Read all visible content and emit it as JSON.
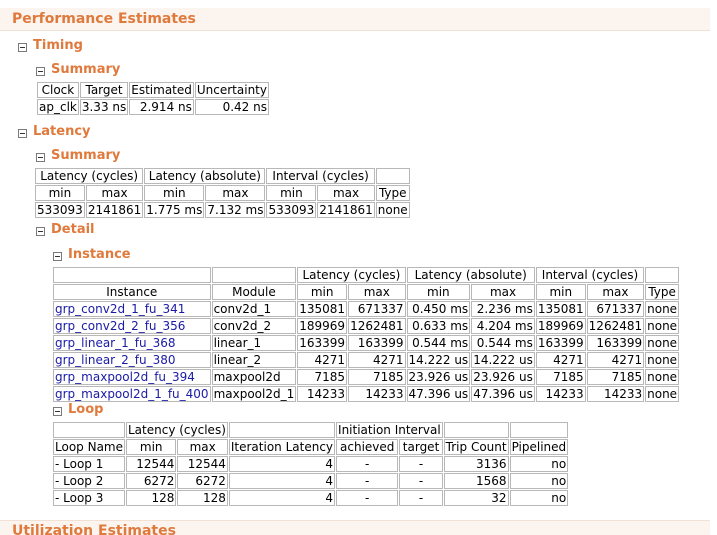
{
  "header": {
    "title": "Performance Estimates"
  },
  "timing": {
    "title": "Timing",
    "summary": {
      "title": "Summary",
      "headers": [
        "Clock",
        "Target",
        "Estimated",
        "Uncertainty"
      ],
      "row": [
        "ap_clk",
        "3.33 ns",
        "2.914 ns",
        "0.42 ns"
      ]
    }
  },
  "latency": {
    "title": "Latency",
    "summary": {
      "title": "Summary",
      "groups": [
        "Latency (cycles)",
        "Latency (absolute)",
        "Interval (cycles)"
      ],
      "subheaders": [
        "min",
        "max",
        "min",
        "max",
        "min",
        "max",
        "Type"
      ],
      "row": [
        "533093",
        "2141861",
        "1.775 ms",
        "7.132 ms",
        "533093",
        "2141861",
        "none"
      ]
    },
    "detail": {
      "title": "Detail",
      "instance": {
        "title": "Instance",
        "groups": [
          "Latency (cycles)",
          "Latency (absolute)",
          "Interval (cycles)"
        ],
        "subheaders": [
          "Instance",
          "Module",
          "min",
          "max",
          "min",
          "max",
          "min",
          "max",
          "Type"
        ],
        "rows": [
          [
            "grp_conv2d_1_fu_341",
            "conv2d_1",
            "135081",
            "671337",
            "0.450 ms",
            "2.236 ms",
            "135081",
            "671337",
            "none"
          ],
          [
            "grp_conv2d_2_fu_356",
            "conv2d_2",
            "189969",
            "1262481",
            "0.633 ms",
            "4.204 ms",
            "189969",
            "1262481",
            "none"
          ],
          [
            "grp_linear_1_fu_368",
            "linear_1",
            "163399",
            "163399",
            "0.544 ms",
            "0.544 ms",
            "163399",
            "163399",
            "none"
          ],
          [
            "grp_linear_2_fu_380",
            "linear_2",
            "4271",
            "4271",
            "14.222 us",
            "14.222 us",
            "4271",
            "4271",
            "none"
          ],
          [
            "grp_maxpool2d_fu_394",
            "maxpool2d",
            "7185",
            "7185",
            "23.926 us",
            "23.926 us",
            "7185",
            "7185",
            "none"
          ],
          [
            "grp_maxpool2d_1_fu_400",
            "maxpool2d_1",
            "14233",
            "14233",
            "47.396 us",
            "47.396 us",
            "14233",
            "14233",
            "none"
          ]
        ]
      },
      "loop": {
        "title": "Loop",
        "groups": [
          "Latency (cycles)",
          "Initiation Interval"
        ],
        "subheaders": [
          "Loop Name",
          "min",
          "max",
          "Iteration Latency",
          "achieved",
          "target",
          "Trip Count",
          "Pipelined"
        ],
        "rows": [
          [
            "- Loop 1",
            "12544",
            "12544",
            "4",
            "-",
            "-",
            "3136",
            "no"
          ],
          [
            "- Loop 2",
            "6272",
            "6272",
            "4",
            "-",
            "-",
            "1568",
            "no"
          ],
          [
            "- Loop 3",
            "128",
            "128",
            "4",
            "-",
            "-",
            "32",
            "no"
          ]
        ]
      }
    }
  },
  "utilization": {
    "title": "Utilization Estimates"
  }
}
